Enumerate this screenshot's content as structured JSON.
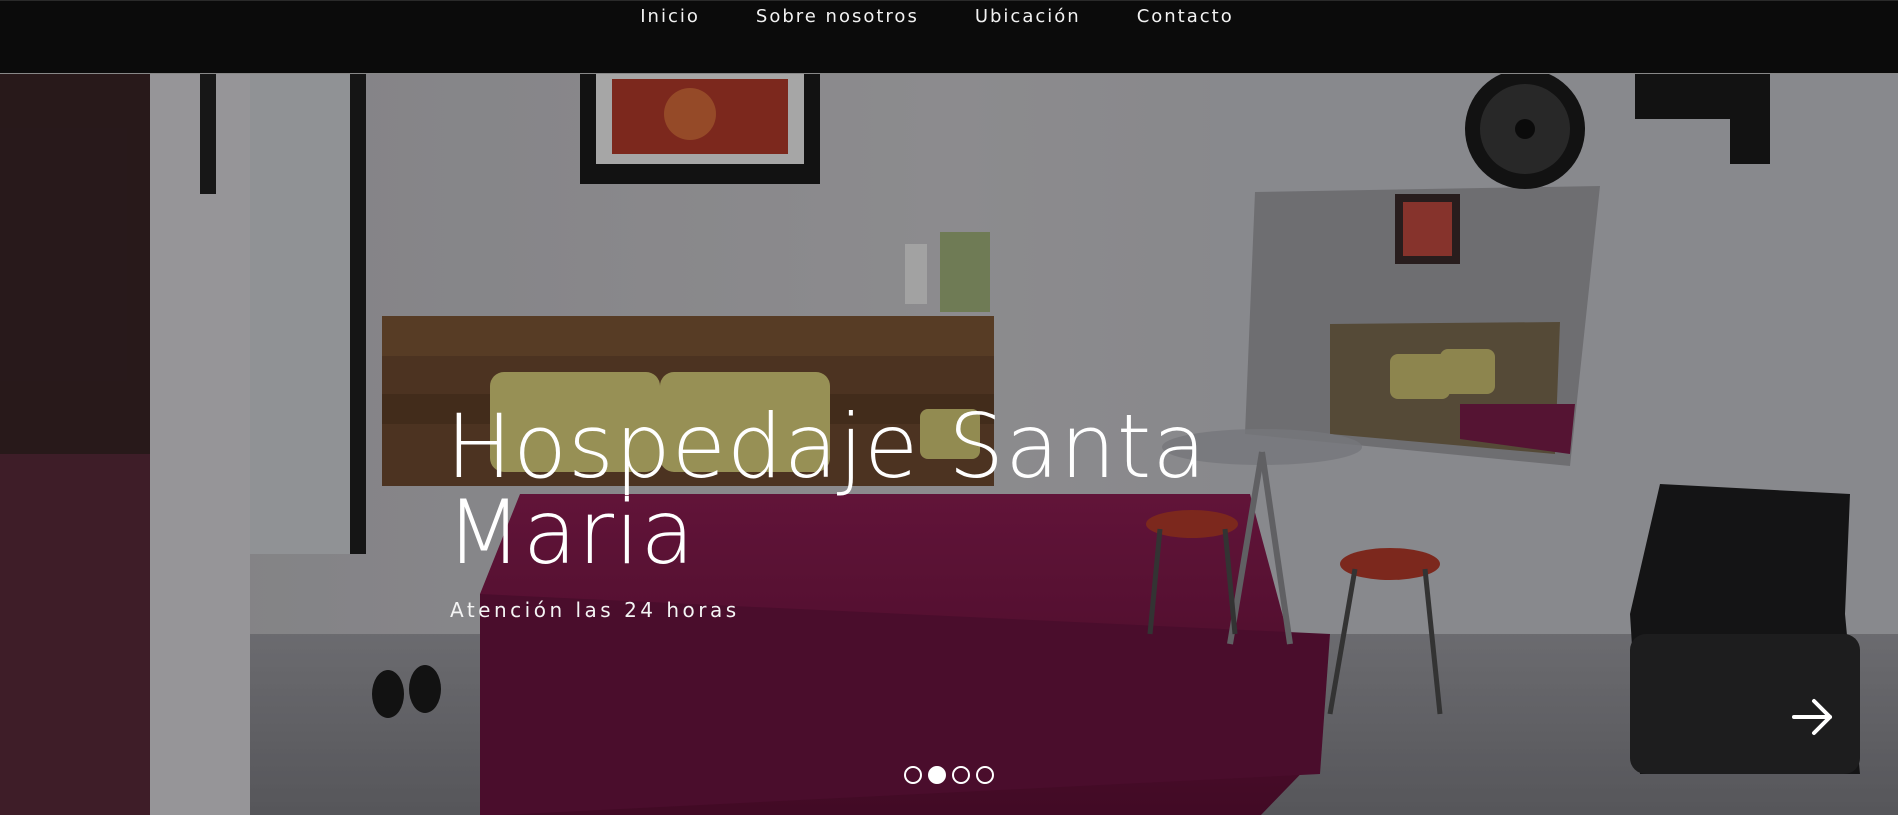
{
  "nav": {
    "items": [
      {
        "label": "Inicio"
      },
      {
        "label": "Sobre nosotros"
      },
      {
        "label": "Ubicación"
      },
      {
        "label": "Contacto"
      }
    ]
  },
  "hero": {
    "title": "Hospedaje Santa Maria",
    "subtitle": "Atención las 24 horas",
    "next_icon": "arrow-right-icon",
    "slides_total": 4,
    "active_slide": 2,
    "image_subject": "hotel room with bed, table and chairs"
  },
  "colors": {
    "topbar": "#0b0b0b",
    "text": "#ffffff",
    "bedspread": "#7a1645"
  }
}
